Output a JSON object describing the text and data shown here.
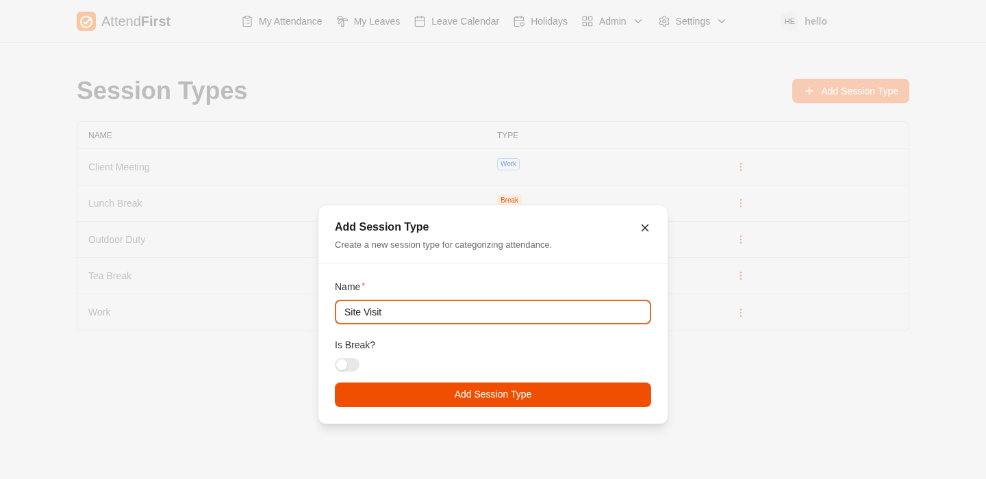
{
  "brand": {
    "name_light": "Attend",
    "name_bold": "First"
  },
  "nav": [
    {
      "label": "My Attendance",
      "dropdown": false
    },
    {
      "label": "My Leaves",
      "dropdown": false
    },
    {
      "label": "Leave Calendar",
      "dropdown": false
    },
    {
      "label": "Holidays",
      "dropdown": false
    },
    {
      "label": "Admin",
      "dropdown": true
    },
    {
      "label": "Settings",
      "dropdown": true
    }
  ],
  "user": {
    "initials": "HE",
    "name": "hello"
  },
  "page": {
    "title": "Session Types",
    "add_button": "Add Session Type"
  },
  "table": {
    "columns": [
      "NAME",
      "TYPE"
    ],
    "rows": [
      {
        "name": "Client Meeting",
        "type": {
          "label": "Work",
          "kind": "work"
        }
      },
      {
        "name": "Lunch Break",
        "type": {
          "label": "Break",
          "kind": "break"
        }
      },
      {
        "name": "Outdoor Duty"
      },
      {
        "name": "Tea Break"
      },
      {
        "name": "Work"
      }
    ]
  },
  "dialog": {
    "title": "Add Session Type",
    "description": "Create a new session type for categorizing attendance.",
    "name_label": "Name",
    "required_mark": "*",
    "name_value": "Site Visit",
    "break_label": "Is Break?",
    "break_on": false,
    "submit": "Add Session Type"
  }
}
